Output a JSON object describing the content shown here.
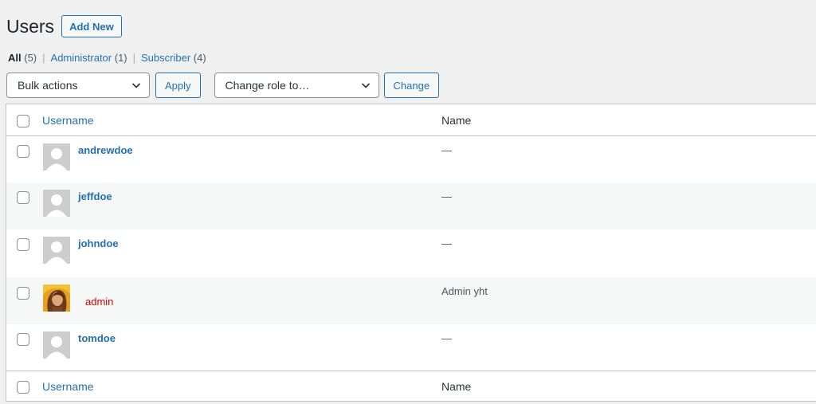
{
  "header": {
    "title": "Users",
    "add_new_label": "Add New"
  },
  "filters": [
    {
      "label": "All",
      "count": "(5)",
      "current": true
    },
    {
      "label": "Administrator",
      "count": "(1)",
      "current": false
    },
    {
      "label": "Subscriber",
      "count": "(4)",
      "current": false
    }
  ],
  "filter_separator": "|",
  "toolbar": {
    "bulk_actions": "Bulk actions",
    "apply_label": "Apply",
    "change_role": "Change role to…",
    "change_label": "Change"
  },
  "table": {
    "columns": {
      "username": "Username",
      "name": "Name"
    },
    "rows": [
      {
        "username": "andrewdoe",
        "name": "—",
        "avatar": "default-avatar-icon"
      },
      {
        "username": "jeffdoe",
        "name": "—",
        "avatar": "default-avatar-icon"
      },
      {
        "username": "johndoe",
        "name": "—",
        "avatar": "default-avatar-icon"
      },
      {
        "username": "admin",
        "name": "Admin yht",
        "avatar": "photo-avatar"
      },
      {
        "username": "tomdoe",
        "name": "—",
        "avatar": "default-avatar-icon"
      }
    ]
  },
  "colors": {
    "link": "#2271b1",
    "admin_username": "#d00000"
  }
}
